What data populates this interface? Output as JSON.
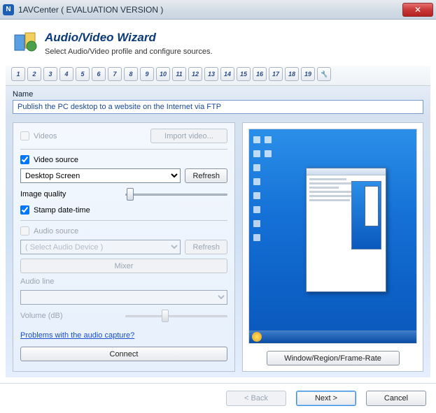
{
  "window": {
    "icon_letter": "N",
    "title": "1AVCenter ( EVALUATION VERSION )"
  },
  "header": {
    "title": "Audio/Video Wizard",
    "subtitle": "Select Audio/Video profile and configure sources."
  },
  "steps": {
    "items": [
      "1",
      "2",
      "3",
      "4",
      "5",
      "6",
      "7",
      "8",
      "9",
      "10",
      "11",
      "12",
      "13",
      "14",
      "15",
      "16",
      "17",
      "18",
      "19"
    ]
  },
  "name": {
    "label": "Name",
    "value": "Publish the PC desktop to a website on the Internet via FTP"
  },
  "left": {
    "videos_label": "Videos",
    "import_video": "Import video...",
    "video_source_label": "Video source",
    "video_source_value": "Desktop Screen",
    "refresh": "Refresh",
    "image_quality": "Image quality",
    "stamp": "Stamp date-time",
    "audio_source_label": "Audio source",
    "audio_source_value": "( Select Audio Device )",
    "mixer": "Mixer",
    "audio_line": "Audio line",
    "volume": "Volume (dB)",
    "problems_link": "Problems with the audio capture?",
    "connect": "Connect"
  },
  "right": {
    "preview_button": "Window/Region/Frame-Rate"
  },
  "footer": {
    "back": "< Back",
    "next": "Next >",
    "cancel": "Cancel"
  }
}
